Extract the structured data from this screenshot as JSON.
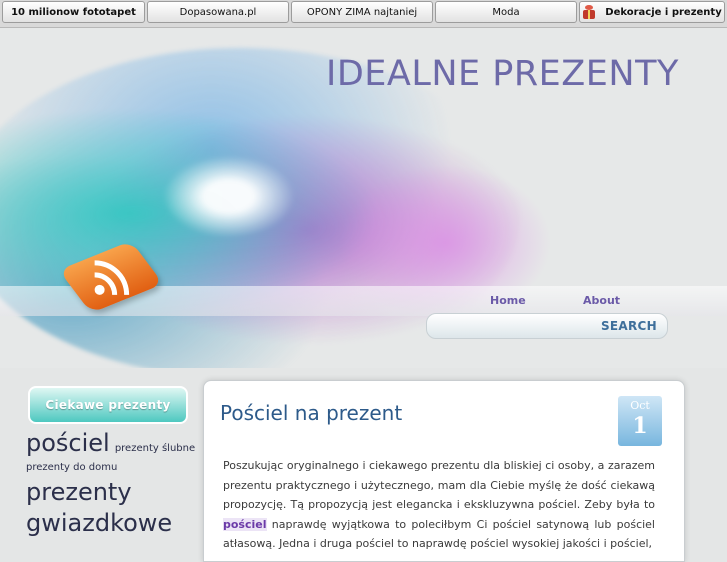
{
  "topbar": {
    "links": [
      {
        "label": "10 milionow fototapet"
      },
      {
        "label": "Dopasowana.pl"
      },
      {
        "label": "OPONY ZIMA najtaniej"
      },
      {
        "label": "Moda"
      },
      {
        "label": "Dekoracje i prezenty",
        "icon": "gift-icon"
      }
    ]
  },
  "header": {
    "site_title": "IDEALNE PREZENTY",
    "nav": {
      "home": "Home",
      "about": "About"
    },
    "search": {
      "button": "SEARCH",
      "placeholder": ""
    }
  },
  "sidebar": {
    "heading": "Ciekawe prezenty",
    "tags": [
      {
        "label": "pościel"
      },
      {
        "label": "prezenty ślubne"
      },
      {
        "label": "prezenty do domu"
      },
      {
        "label": "prezenty"
      },
      {
        "label": "gwiazdkowe"
      }
    ]
  },
  "post": {
    "title": "Pościel na prezent",
    "date_month": "Oct",
    "date_day": "1",
    "body_before": "Poszukując oryginalnego i ciekawego prezentu dla bliskiej ci osoby, a zarazem prezentu praktycznego i użytecznego, mam dla Ciebie myślę że dość ciekawą propozycję. Tą propozycją jest elegancka i ekskluzywna pościel. Zeby była to ",
    "body_link": "pościel",
    "body_after": " naprawdę wyjątkowa to poleciłbym Ci pościel satynową lub pościel atłasową. Jedna i druga pościel to naprawdę pościel wysokiej jakości i pościel,"
  },
  "colors": {
    "title": "#6d6aa8",
    "nav": "#6b5aa8",
    "post_title": "#2d5a8a",
    "accent_teal": "#4ec8c0"
  }
}
